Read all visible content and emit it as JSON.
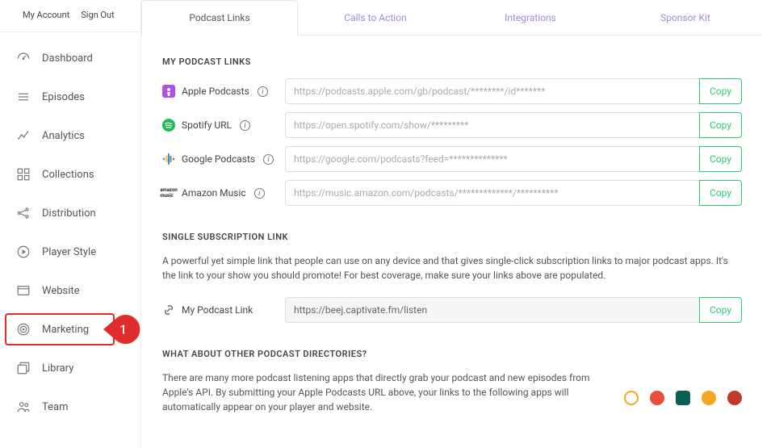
{
  "topnav": {
    "my_account": "My Account",
    "sign_out": "Sign Out"
  },
  "sidebar": {
    "items": [
      {
        "label": "Dashboard"
      },
      {
        "label": "Episodes"
      },
      {
        "label": "Analytics"
      },
      {
        "label": "Collections"
      },
      {
        "label": "Distribution"
      },
      {
        "label": "Player Style"
      },
      {
        "label": "Website"
      },
      {
        "label": "Marketing"
      },
      {
        "label": "Library"
      },
      {
        "label": "Team"
      }
    ]
  },
  "annotation": {
    "marketing_step": "1"
  },
  "tabs": {
    "items": [
      {
        "label": "Podcast Links"
      },
      {
        "label": "Calls to Action"
      },
      {
        "label": "Integrations"
      },
      {
        "label": "Sponsor Kit"
      }
    ]
  },
  "links_section": {
    "title": "MY PODCAST LINKS",
    "services": [
      {
        "name": "Apple Podcasts",
        "placeholder": "https://podcasts.apple.com/gb/podcast/********/id*******"
      },
      {
        "name": "Spotify URL",
        "placeholder": "https://open.spotify.com/show/*********"
      },
      {
        "name": "Google Podcasts",
        "placeholder": "https://google.com/podcasts?feed=**************"
      },
      {
        "name": "Amazon Music",
        "placeholder": "https://music.amazon.com/podcasts/*************/**********"
      }
    ],
    "copy": "Copy"
  },
  "single_section": {
    "title": "SINGLE SUBSCRIPTION LINK",
    "body": "A powerful yet simple link that people can use on any device and that gives single-click subscription links to major podcast apps. It's the link to your show you should promote! For best coverage, make sure your links above are populated.",
    "label": "My Podcast Link",
    "value": "https://beej.captivate.fm/listen",
    "copy": "Copy"
  },
  "directories_section": {
    "title": "WHAT ABOUT OTHER PODCAST DIRECTORIES?",
    "body": "There are many more podcast listening apps that directly grab your podcast and new episodes from Apple's API. By submitting your Apple Podcasts URL above, your links to the following apps will automatically appear on your player and website."
  },
  "colors": {
    "annotation": "#e02c2c",
    "tab_inactive": "#a389d4",
    "copy_btn": "#2ecc71"
  }
}
